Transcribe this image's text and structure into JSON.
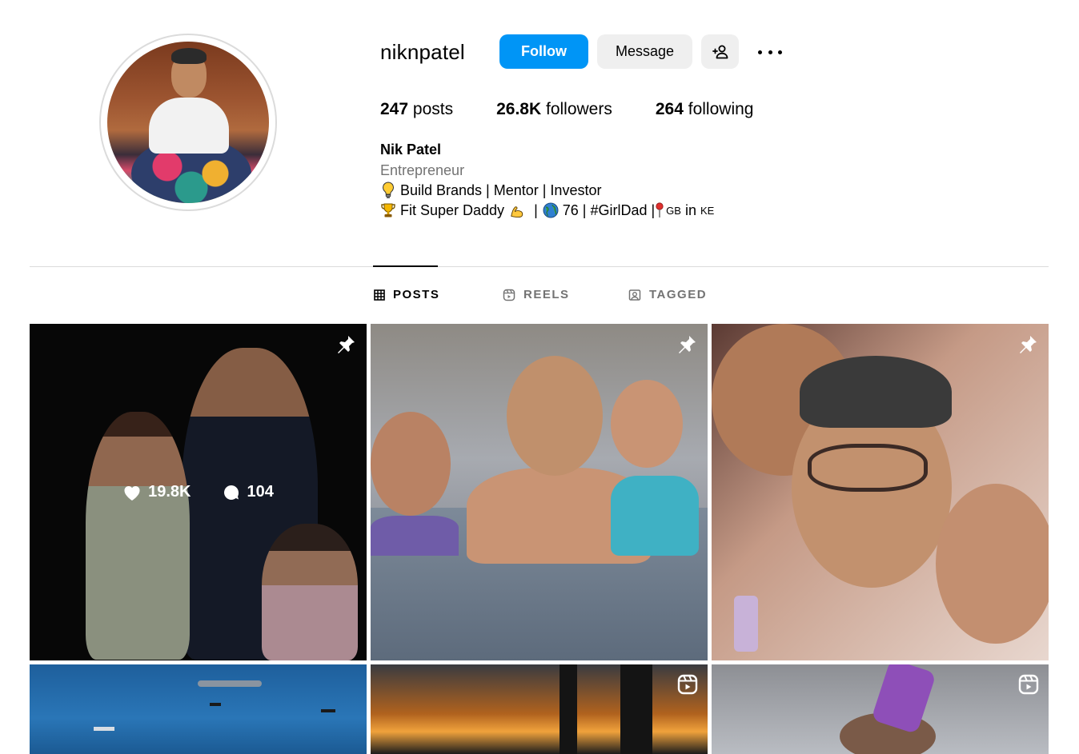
{
  "profile": {
    "username": "niknpatel",
    "full_name": "Nik Patel",
    "category": "Entrepreneur",
    "bio_line_1": "Build Brands | Mentor | Investor",
    "bio_line_2_a": "Fit Super Daddy",
    "bio_line_2_b": "|",
    "bio_line_2_c": "76 | #GirlDad |",
    "bio_line_2_d": "GB",
    "bio_line_2_e": "in",
    "bio_line_2_f": "KE",
    "bio_line_1_icon": "lightbulb-icon",
    "bio_line_2_icons": [
      "trophy-icon",
      "flexed-biceps-icon",
      "globe-icon",
      "pin-icon"
    ]
  },
  "actions": {
    "follow_label": "Follow",
    "message_label": "Message",
    "suggest_icon": "add-person-icon",
    "more_icon": "more-horizontal-icon"
  },
  "stats": {
    "posts_count": "247",
    "posts_label": "posts",
    "followers_count": "26.8K",
    "followers_label": "followers",
    "following_count": "264",
    "following_label": "following"
  },
  "tabs": [
    {
      "label": "POSTS",
      "icon": "grid-icon",
      "active": true
    },
    {
      "label": "REELS",
      "icon": "reels-icon",
      "active": false
    },
    {
      "label": "TAGGED",
      "icon": "tagged-icon",
      "active": false
    }
  ],
  "posts": [
    {
      "pinned": true,
      "hover": true,
      "likes": "19.8K",
      "comments": "104"
    },
    {
      "pinned": true
    },
    {
      "pinned": true
    },
    {
      "pinned": false
    },
    {
      "pinned": false,
      "reel": true
    },
    {
      "pinned": false,
      "reel": true
    }
  ],
  "colors": {
    "accent": "#0095f6",
    "secondary_button": "#efefef",
    "muted_text": "#737373",
    "divider": "#dbdbdb"
  }
}
